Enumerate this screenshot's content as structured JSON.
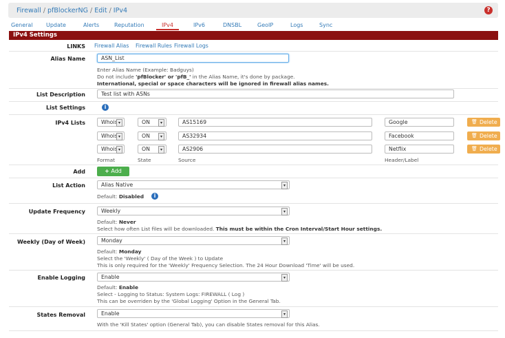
{
  "breadcrumb": [
    "Firewall",
    "pfBlockerNG",
    "Edit",
    "IPv4"
  ],
  "breadcrumb_sep": "/",
  "tabs": [
    "General",
    "Update",
    "Alerts",
    "Reputation",
    "IPv4",
    "IPv6",
    "DNSBL",
    "GeoIP",
    "Logs",
    "Sync"
  ],
  "active_tab": "IPv4",
  "panel_title": "IPv4 Settings",
  "links": {
    "label": "LINKS",
    "items": [
      "Firewall Alias",
      "Firewall Rules",
      "Firewall Logs"
    ]
  },
  "alias_name": {
    "label": "Alias Name",
    "value": "ASN_List",
    "help1": "Enter Alias Name (Example: Badguys)",
    "help2_pre": "Do not include ",
    "help2_b1": "'pfBlocker' or 'pfB_'",
    "help2_post": " in the Alias Name, it's done by package.",
    "help3": "International, special or space characters will be ignored in firewall alias names."
  },
  "list_description": {
    "label": "List Description",
    "value": "Test list with ASNs"
  },
  "list_settings": {
    "label": "List Settings"
  },
  "ipv4_lists": {
    "label": "IPv4 Lists",
    "rows": [
      {
        "format": "Whois",
        "state": "ON",
        "source": "AS15169",
        "header": "Google",
        "delete": "Delete"
      },
      {
        "format": "Whois",
        "state": "ON",
        "source": "AS32934",
        "header": "Facebook",
        "delete": "Delete"
      },
      {
        "format": "Whois",
        "state": "ON",
        "source": "AS2906",
        "header": "Netflix",
        "delete": "Delete"
      }
    ],
    "captions": {
      "format": "Format",
      "state": "State",
      "source": "Source",
      "header": "Header/Label"
    }
  },
  "add": {
    "label": "Add",
    "button": "Add"
  },
  "list_action": {
    "label": "List Action",
    "value": "Alias Native",
    "default_pre": "Default: ",
    "default_val": "Disabled"
  },
  "update_frequency": {
    "label": "Update Frequency",
    "value": "Weekly",
    "default_pre": "Default: ",
    "default_val": "Never",
    "help_pre": "Select how often List files will be downloaded. ",
    "help_b": "This must be within the Cron Interval/Start Hour settings."
  },
  "weekly": {
    "label": "Weekly (Day of Week)",
    "value": "Monday",
    "default_pre": "Default: ",
    "default_val": "Monday",
    "help1": "Select the 'Weekly' ( Day of the Week ) to Update",
    "help2": "This is only required for the 'Weekly' Frequency Selection. The 24 Hour Download 'Time' will be used."
  },
  "enable_logging": {
    "label": "Enable Logging",
    "value": "Enable",
    "default_pre": "Default: ",
    "default_val": "Enable",
    "help1": "Select - Logging to Status: System Logs: FIREWALL ( Log )",
    "help2": "This can be overriden by the 'Global Logging' Option in the General Tab."
  },
  "states_removal": {
    "label": "States Removal",
    "value": "Enable",
    "help": "With the 'Kill States' option (General Tab), you can disable States removal for this Alias."
  },
  "colors": {
    "panel_header": "#8b1010",
    "link": "#337ab7",
    "delete": "#f0ad4e",
    "add": "#4cae4c"
  }
}
